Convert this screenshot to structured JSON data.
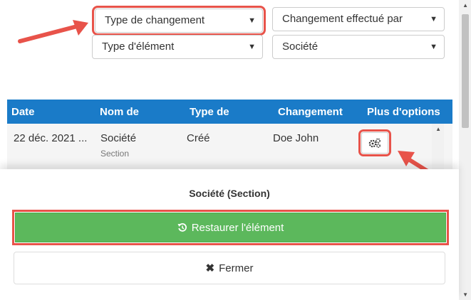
{
  "filters": {
    "change_type": "Type de changement",
    "changed_by": "Changement effectué par",
    "element_type": "Type d'élément",
    "company": "Société"
  },
  "table": {
    "columns": [
      "Date",
      "Nom de",
      "Type de",
      "Changement",
      "Plus d'options"
    ],
    "rows": [
      {
        "date": "22 déc. 2021 ...",
        "name": "Société",
        "name_sub": "Section",
        "type": "Créé",
        "changed_by": "Doe John"
      }
    ]
  },
  "panel": {
    "title": "Société (Section)",
    "restore_label": "Restaurer l'élément",
    "close_label": "Fermer"
  },
  "colors": {
    "header_blue": "#1a7bc8",
    "success_green": "#5cb85c",
    "highlight_red": "#e8534a"
  },
  "icons": [
    "chevron-down-icon",
    "gears-icon",
    "restore-icon",
    "close-icon",
    "arrow-icon"
  ]
}
